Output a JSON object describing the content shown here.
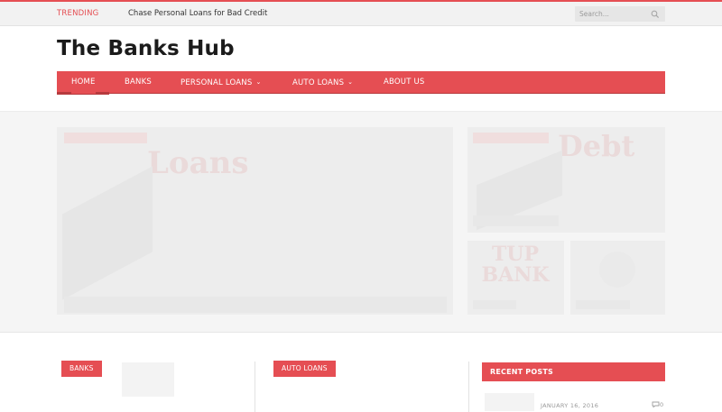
{
  "topbar": {
    "trending_label": "TRENDING",
    "trending_item": "Chase Personal Loans for Bad Credit",
    "search_placeholder": "Search..."
  },
  "header": {
    "site_title": "The Banks Hub"
  },
  "nav": {
    "items": [
      {
        "label": "HOME",
        "active": true
      },
      {
        "label": "BANKS"
      },
      {
        "label": "PERSONAL LOANS",
        "dropdown": true
      },
      {
        "label": "AUTO LOANS",
        "dropdown": true
      },
      {
        "label": "ABOUT US"
      }
    ],
    "dropdown_glyph": "⌄"
  },
  "featured": {
    "main_image_text": "Loans",
    "side_image_text": "Debt",
    "bank_image_text": "TUP BANK"
  },
  "content": {
    "col1_tag": "BANKS",
    "col2_tag": "AUTO LOANS"
  },
  "sidebar": {
    "recent_title": "RECENT POSTS",
    "first_post_date": "JANUARY 16, 2016",
    "first_post_comments": "0"
  },
  "colors": {
    "accent": "#e54e53",
    "accent_dark": "#b63a3e",
    "text_dark": "#1b1b1b",
    "topbar_bg": "#f2f2f2"
  },
  "icons": {
    "search": "search-icon",
    "comment": "comment-icon"
  }
}
